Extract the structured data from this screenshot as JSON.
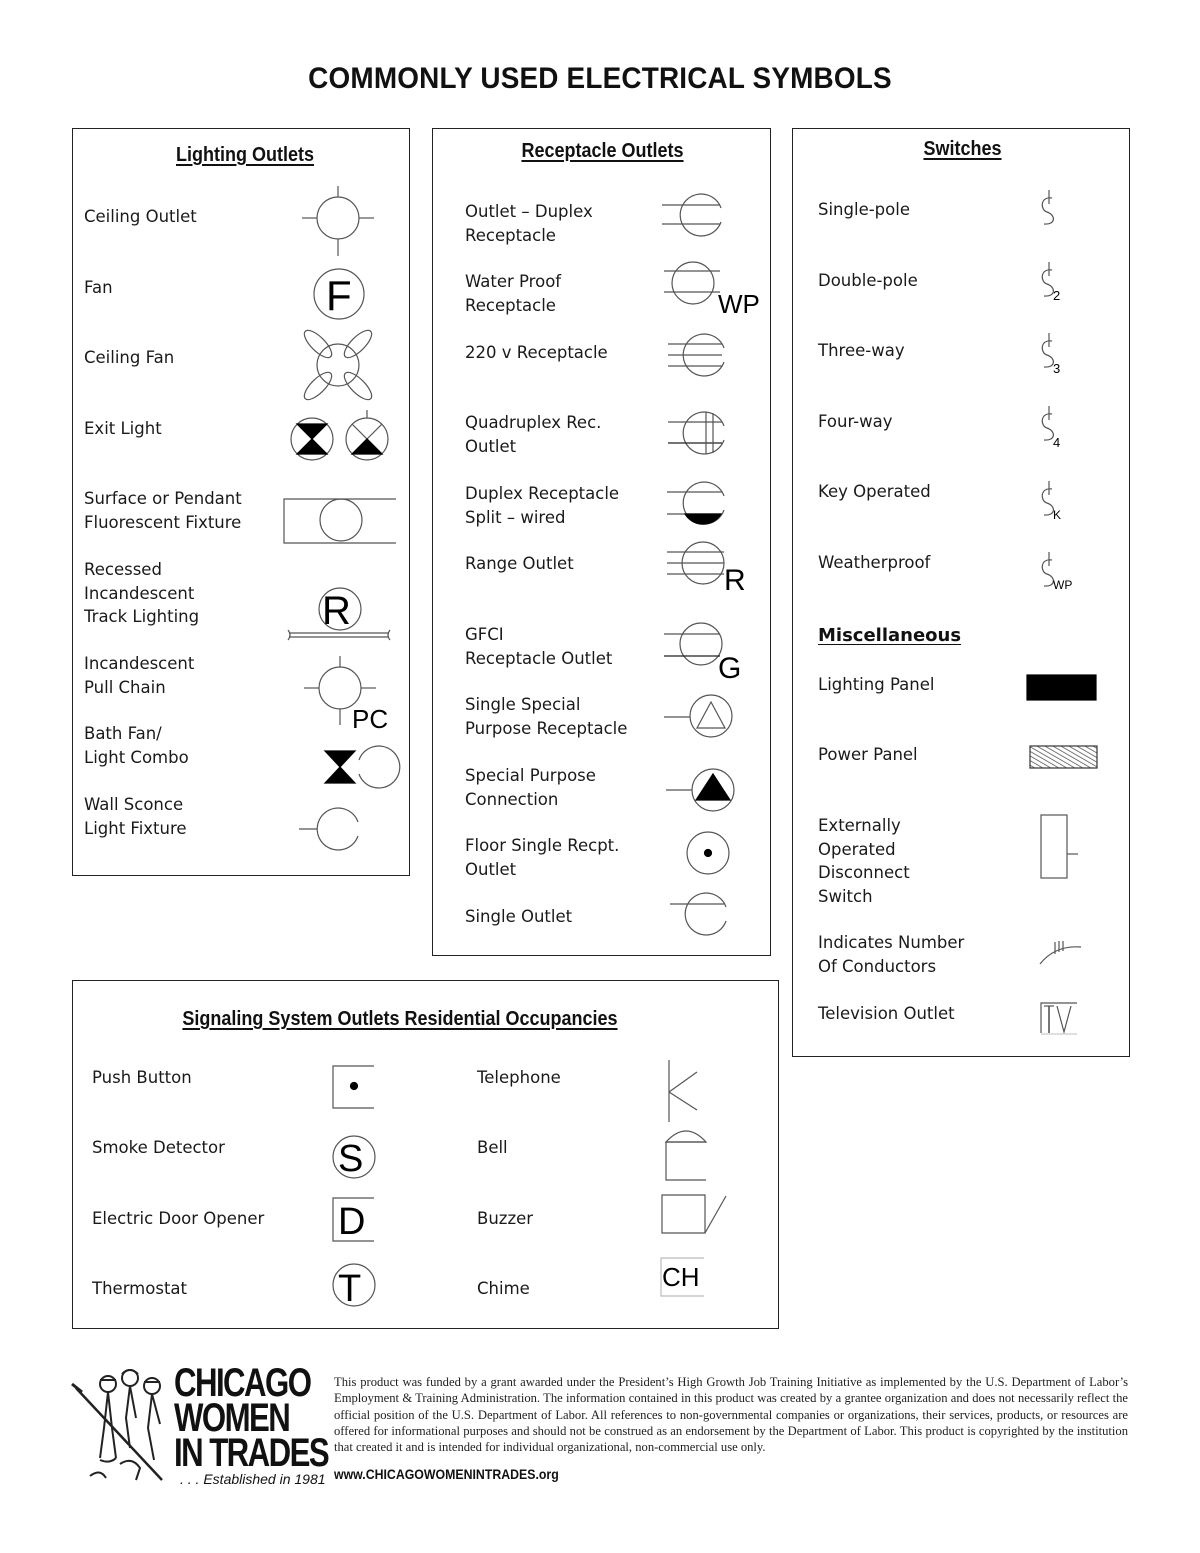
{
  "page": {
    "title": "COMMONLY USED ELECTRICAL SYMBOLS"
  },
  "lighting": {
    "heading": "Lighting Outlets",
    "items": [
      {
        "label": "Ceiling Outlet",
        "icon": "ceiling-outlet-icon"
      },
      {
        "label": "Fan",
        "icon": "fan-icon",
        "mark": "F"
      },
      {
        "label": "Ceiling Fan",
        "icon": "ceiling-fan-icon"
      },
      {
        "label": "Exit Light",
        "icon": "exit-light-icon"
      },
      {
        "label": "Surface or Pendant\nFluorescent Fixture",
        "icon": "fluorescent-fixture-icon"
      },
      {
        "label": "Recessed\nIncandescent\nTrack Lighting",
        "icon": "track-lighting-icon",
        "mark": "R"
      },
      {
        "label": "Incandescent\nPull Chain",
        "icon": "pull-chain-icon",
        "mark": "PC"
      },
      {
        "label": "Bath Fan/\nLight Combo",
        "icon": "bath-fan-light-icon"
      },
      {
        "label": "Wall Sconce\nLight Fixture",
        "icon": "wall-sconce-icon"
      }
    ]
  },
  "receptacle": {
    "heading": "Receptacle Outlets",
    "items": [
      {
        "label": "Outlet – Duplex\nReceptacle",
        "icon": "duplex-receptacle-icon"
      },
      {
        "label": "Water Proof\nReceptacle",
        "icon": "waterproof-receptacle-icon",
        "mark": "WP"
      },
      {
        "label": "220 v Receptacle",
        "icon": "220v-receptacle-icon"
      },
      {
        "label": "Quadruplex Rec.\nOutlet",
        "icon": "quadruplex-outlet-icon"
      },
      {
        "label": "Duplex Receptacle\nSplit – wired",
        "icon": "split-wired-receptacle-icon"
      },
      {
        "label": "Range Outlet",
        "icon": "range-outlet-icon",
        "mark": "R"
      },
      {
        "label": "GFCI\nReceptacle Outlet",
        "icon": "gfci-outlet-icon",
        "mark": "G"
      },
      {
        "label": "Single Special\nPurpose Receptacle",
        "icon": "special-purpose-receptacle-icon"
      },
      {
        "label": "Special Purpose\nConnection",
        "icon": "special-purpose-connection-icon"
      },
      {
        "label": "Floor Single Recpt.\nOutlet",
        "icon": "floor-outlet-icon"
      },
      {
        "label": "Single Outlet",
        "icon": "single-outlet-icon"
      }
    ]
  },
  "switches": {
    "heading": "Switches",
    "items": [
      {
        "label": "Single-pole",
        "icon": "switch-single-pole-icon",
        "sub": ""
      },
      {
        "label": "Double-pole",
        "icon": "switch-double-pole-icon",
        "sub": "2"
      },
      {
        "label": "Three-way",
        "icon": "switch-three-way-icon",
        "sub": "3"
      },
      {
        "label": "Four-way",
        "icon": "switch-four-way-icon",
        "sub": "4"
      },
      {
        "label": "Key Operated",
        "icon": "switch-key-operated-icon",
        "sub": "K"
      },
      {
        "label": "Weatherproof",
        "icon": "switch-weatherproof-icon",
        "sub": "WP"
      }
    ]
  },
  "misc": {
    "heading": "Miscellaneous",
    "items": [
      {
        "label": "Lighting Panel",
        "icon": "lighting-panel-icon"
      },
      {
        "label": "Power Panel",
        "icon": "power-panel-icon"
      },
      {
        "label": "Externally\nOperated\nDisconnect\nSwitch",
        "icon": "disconnect-switch-icon"
      },
      {
        "label": "Indicates Number\nOf Conductors",
        "icon": "conductors-icon"
      },
      {
        "label": "Television Outlet",
        "icon": "tv-outlet-icon",
        "mark": "TV"
      }
    ]
  },
  "signaling": {
    "heading": "Signaling System Outlets Residential Occupancies",
    "left": [
      {
        "label": "Push Button",
        "icon": "push-button-icon"
      },
      {
        "label": "Smoke Detector",
        "icon": "smoke-detector-icon",
        "mark": "S"
      },
      {
        "label": "Electric Door Opener",
        "icon": "door-opener-icon",
        "mark": "D"
      },
      {
        "label": "Thermostat",
        "icon": "thermostat-icon",
        "mark": "T"
      }
    ],
    "right": [
      {
        "label": "Telephone",
        "icon": "telephone-icon"
      },
      {
        "label": "Bell",
        "icon": "bell-icon"
      },
      {
        "label": "Buzzer",
        "icon": "buzzer-icon"
      },
      {
        "label": "Chime",
        "icon": "chime-icon",
        "mark": "CH"
      }
    ]
  },
  "footer": {
    "logo_lines": [
      "CHICAGO",
      "WOMEN",
      "IN TRADES"
    ],
    "established": ". . . Established in 1981",
    "disclaimer": "This product was funded by a grant awarded under the President’s High Growth Job Training Initiative as implemented by the U.S. Department of Labor’s Employment & Training Administration.  The information contained in this product was created by a grantee organization and does not necessarily reflect the official position of the U.S. Department of Labor. All references to non-governmental companies or organizations, their services, products, or resources are offered for informational purposes and should not be construed as an endorsement by the Department of Labor.  This product is copyrighted by the institution that created it and is intended for individual organizational, non-commercial use only.",
    "url": "www.CHICAGOWOMENINTRADES.org"
  }
}
